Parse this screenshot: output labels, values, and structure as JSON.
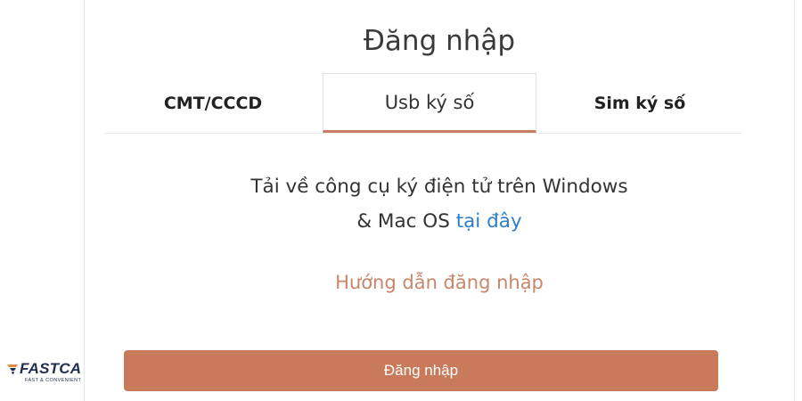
{
  "login": {
    "title": "Đăng nhập",
    "tabs": [
      {
        "label": "CMT/CCCD",
        "active": false
      },
      {
        "label": "Usb ký số",
        "active": true
      },
      {
        "label": "Sim ký số",
        "active": false
      }
    ],
    "description_line1": "Tải về công cụ ký điện tử trên Windows",
    "description_line2_prefix": "& Mac OS ",
    "description_link": "tại đây",
    "guide_link": "Hướng dẫn đăng nhập",
    "login_button": "Đăng nhập"
  },
  "brand": {
    "name": "FASTCA",
    "tagline": "FAST & CONVENIENT",
    "icon": "fastca-logo"
  },
  "colors": {
    "accent": "#c97a5a",
    "link": "#2f7fc6",
    "guide": "#c8866a"
  }
}
